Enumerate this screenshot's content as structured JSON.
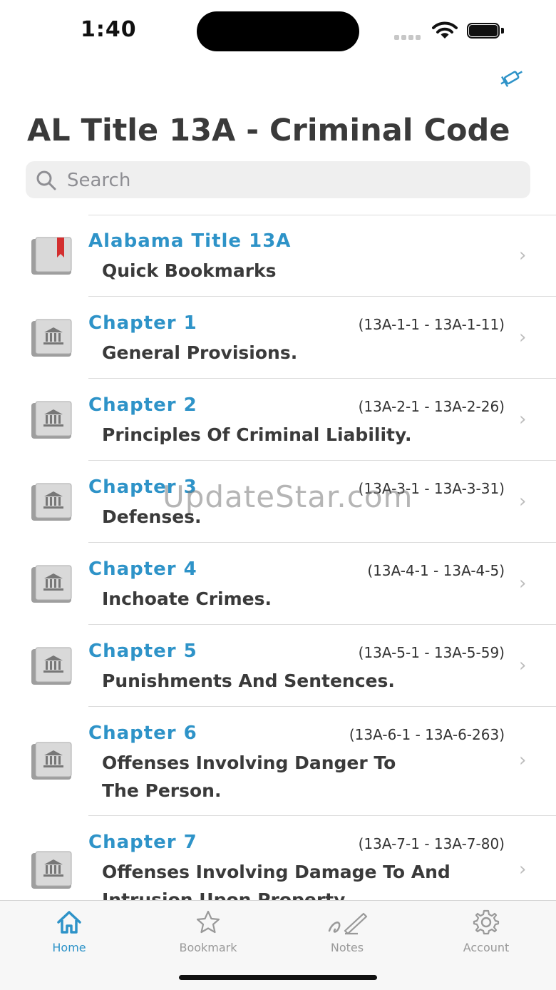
{
  "status": {
    "time": "1:40"
  },
  "header": {
    "title": "AL Title 13A - Criminal Code"
  },
  "search": {
    "placeholder": "Search"
  },
  "bookmarks_row": {
    "title": "Alabama Title 13A",
    "subtitle": "Quick Bookmarks"
  },
  "chapters": [
    {
      "title": "Chapter  1",
      "range": "(13A-1-1 - 13A-1-11)",
      "subtitle": "General Provisions."
    },
    {
      "title": "Chapter  2",
      "range": "(13A-2-1 - 13A-2-26)",
      "subtitle": "Principles Of Criminal Liability."
    },
    {
      "title": "Chapter  3",
      "range": "(13A-3-1 - 13A-3-31)",
      "subtitle": "Defenses."
    },
    {
      "title": "Chapter  4",
      "range": "(13A-4-1 - 13A-4-5)",
      "subtitle": "Inchoate Crimes."
    },
    {
      "title": "Chapter  5",
      "range": "(13A-5-1 - 13A-5-59)",
      "subtitle": "Punishments And Sentences."
    },
    {
      "title": "Chapter  6",
      "range": "(13A-6-1 - 13A-6-263)",
      "subtitle": "Offenses Involving Danger To The Person."
    },
    {
      "title": "Chapter  7",
      "range": "(13A-7-1 - 13A-7-80)",
      "subtitle": "Offenses Involving Damage To And Intrusion Upon Property."
    }
  ],
  "watermark": "UpdateStar.com",
  "tabs": [
    {
      "label": "Home",
      "icon": "home-icon",
      "active": true
    },
    {
      "label": "Bookmark",
      "icon": "star-icon",
      "active": false
    },
    {
      "label": "Notes",
      "icon": "pen-icon",
      "active": false
    },
    {
      "label": "Account",
      "icon": "gear-icon",
      "active": false
    }
  ],
  "colors": {
    "accent": "#2e93c8",
    "text": "#3a3a3a",
    "separator": "#dcdcdc",
    "bookmark_ribbon": "#d32f2f"
  }
}
